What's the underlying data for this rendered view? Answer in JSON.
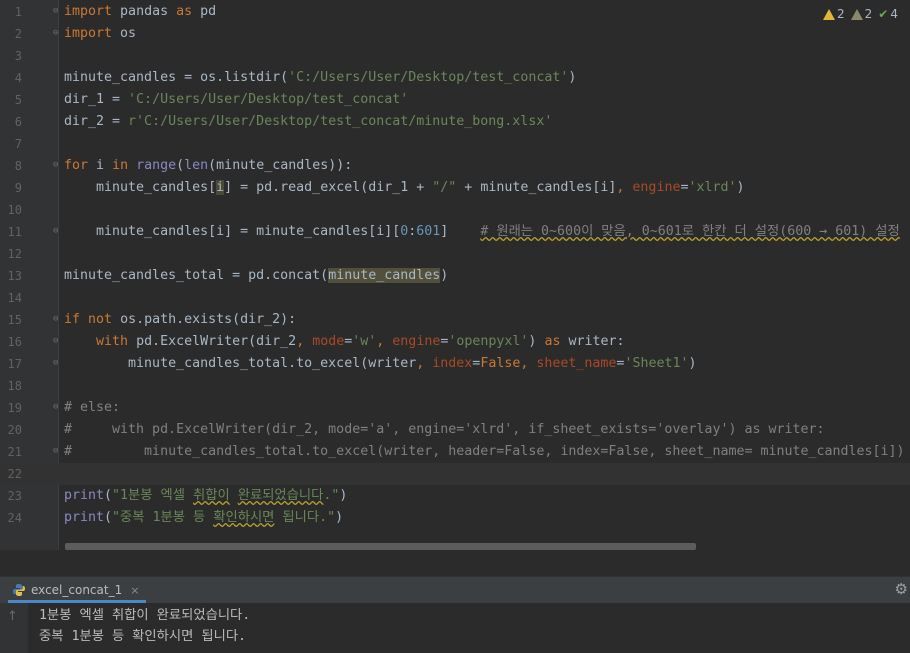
{
  "editor": {
    "inspections": {
      "warnings": "2",
      "weak_warnings": "2",
      "typos": "4"
    },
    "line_numbers": [
      "1",
      "2",
      "3",
      "4",
      "5",
      "6",
      "7",
      "8",
      "9",
      "10",
      "11",
      "12",
      "13",
      "14",
      "15",
      "16",
      "17",
      "18",
      "19",
      "20",
      "21",
      "22",
      "23",
      "24"
    ],
    "tokens": {
      "l1_kw_import": "import",
      "l1_mod": " pandas ",
      "l1_kw_as": "as",
      "l1_alias": " pd",
      "l2_kw_import": "import",
      "l2_mod": " os",
      "l4_a": "minute_candles = os.listdir(",
      "l4_str": "'C:/Users/User/Desktop/test_concat'",
      "l4_b": ")",
      "l5_a": "dir_1 = ",
      "l5_str": "'C:/Users/User/Desktop/test_concat'",
      "l6_a": "dir_2 = ",
      "l6_str": "r'C:/Users/User/Desktop/test_concat/minute_bong.xlsx'",
      "l8_kw_for": "for",
      "l8_a": " i ",
      "l8_kw_in": "in",
      "l8_sp": " ",
      "l8_range": "range",
      "l8_b": "(",
      "l8_len": "len",
      "l8_c": "(minute_candles)):",
      "l9_a": "    minute_candles[",
      "l9_i": "i",
      "l9_b": "] = pd.read_excel(dir_1 + ",
      "l9_str": "\"/\"",
      "l9_c": " + minute_candles[i]",
      "l9_comma": ", ",
      "l9_param": "engine",
      "l9_eq": "=",
      "l9_str2": "'xlrd'",
      "l9_d": ")",
      "l11_a": "    minute_candles[i] = minute_candles[i][",
      "l11_n0": "0",
      "l11_colon": ":",
      "l11_n601": "601",
      "l11_b": "]    ",
      "l11_cmt": "# 원래는 0~600이 맞음, 0~601로 한칸 더 설정(600 → 601) 설정",
      "l13_a": "minute_candles_total = pd.concat(",
      "l13_hl": "minute_candles",
      "l13_b": ")",
      "l15_kw_if": "if",
      "l15_sp": " ",
      "l15_kw_not": "not",
      "l15_a": " os.path.exists(dir_2):",
      "l16_ind": "    ",
      "l16_kw_with": "with",
      "l16_a": " pd.ExcelWriter(dir_2",
      "l16_c1": ", ",
      "l16_p_mode": "mode",
      "l16_eq1": "=",
      "l16_s_w": "'w'",
      "l16_c2": ", ",
      "l16_p_engine": "engine",
      "l16_eq2": "=",
      "l16_s_openpyxl": "'openpyxl'",
      "l16_b": ") ",
      "l16_kw_as": "as",
      "l16_c": " writer:",
      "l17_a": "        minute_candles_total.to_excel(writer",
      "l17_c1": ", ",
      "l17_p_index": "index",
      "l17_eq1": "=",
      "l17_false": "False",
      "l17_c2": ", ",
      "l17_p_sheet": "sheet_name",
      "l17_eq2": "=",
      "l17_s_sheet": "'Sheet1'",
      "l17_b": ")",
      "l19_cmt": "# else:",
      "l20_cmt": "#     with pd.ExcelWriter(dir_2, mode='a', engine='xlrd', if_sheet_exists='overlay') as writer:",
      "l21_cmt": "#         minute_candles_total.to_excel(writer, header=False, index=False, sheet_name= minute_candles[i])",
      "l23_print": "print",
      "l23_a": "(",
      "l23_s1": "\"1분봉 엑셀 ",
      "l23_s_w1": "취합이",
      "l23_s2": " ",
      "l23_s_w2": "완료되었습니다",
      "l23_s3": ".\"",
      "l23_b": ")",
      "l24_print": "print",
      "l24_a": "(",
      "l24_s1": "\"중복 1분봉 등 ",
      "l24_s_w1": "확인하시면",
      "l24_s2": " 됩니다.\"",
      "l24_b": ")"
    }
  },
  "run_panel": {
    "tab_label": "excel_concat_1",
    "close_glyph": "×",
    "gear_glyph": "⚙",
    "up_arrow_glyph": "↑",
    "output_lines": [
      "1분봉 엑셀 취합이 완료되었습니다.",
      "중복 1분봉 등 확인하시면 됩니다."
    ]
  }
}
